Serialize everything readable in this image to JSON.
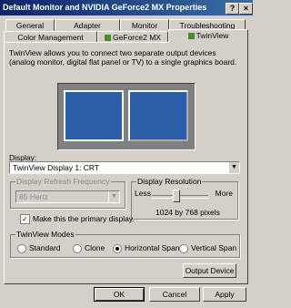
{
  "window": {
    "title": "Default Monitor and NVIDIA GeForce2 MX Properties"
  },
  "tabs_row1": [
    "General",
    "Adapter",
    "Monitor",
    "Troubleshooting"
  ],
  "tabs_row2": [
    "Color Management",
    "GeForce2 MX",
    "TwinView"
  ],
  "description": "TwinView allows you to connect two separate output devices (analog monitor, digital flat panel or TV) to a single graphics board.",
  "display": {
    "label": "Display:",
    "value": "TwinView Display 1: CRT"
  },
  "refresh": {
    "label": "Display Refresh Frequency",
    "value": "85 Hertz"
  },
  "resolution": {
    "label": "Display Resolution",
    "less": "Less",
    "more": "More",
    "value": "1024 by 768 pixels"
  },
  "primary": {
    "label": "Make this the primary display.",
    "checked": true
  },
  "modes": {
    "label": "TwinView Modes",
    "options": [
      "Standard",
      "Clone",
      "Horizontal Span",
      "Vertical Span"
    ],
    "selected": "Horizontal Span"
  },
  "buttons": {
    "output_device": "Output Device",
    "ok": "OK",
    "cancel": "Cancel",
    "apply": "Apply"
  }
}
